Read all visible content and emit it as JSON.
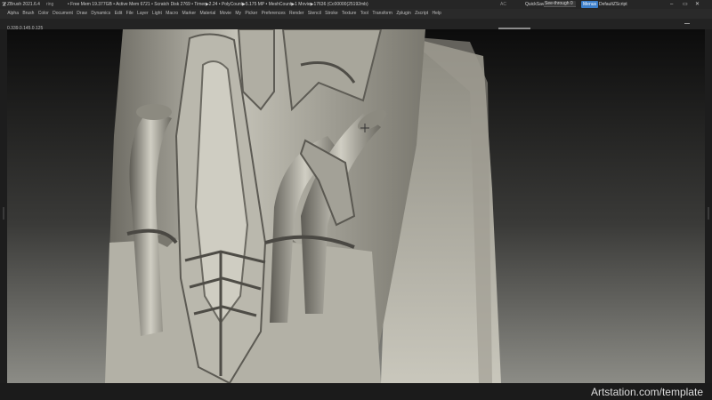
{
  "titlebar": {
    "app_title": "ZBrush 2021.6.4",
    "doc_name": "ring",
    "stats": "• Free Mem 19.377GB • Active Mem 6721 • Scratch Disk 2769 • Timer▶2.24 • PolyCount▶5.175 MP • MeshCount▶1  Movie▶17636 (Cc00000(25192mb)",
    "ac_label": "AC",
    "quicksave_label": "QuickSave",
    "seethrough_label": "See-through  0",
    "menus_label": "Menus",
    "script_label": "DefaultZScript",
    "minimize": "–",
    "restore": "▭",
    "close": "✕"
  },
  "menubar": {
    "items": [
      "Alpha",
      "Brush",
      "Color",
      "Document",
      "Draw",
      "Dynamics",
      "Edit",
      "File",
      "Layer",
      "Light",
      "Macro",
      "Marker",
      "Material",
      "Movie",
      "My",
      "Picker",
      "Preferences",
      "Render",
      "Stencil",
      "Stroke",
      "Texture",
      "Tool",
      "Transform",
      "Zplugin",
      "Zscript",
      "Help"
    ]
  },
  "readout": {
    "value": "0.339,0.145,0.125"
  },
  "watermark": "Artstation.com/template",
  "colors": {
    "accent": "#3c7ec9",
    "clay": "#b8b6ab",
    "background_top": "#0c0c0c",
    "background_bottom": "#8c8c86"
  },
  "icons": {
    "app_logo": "zbrush-logo-icon",
    "cursor": "brush-cursor-icon"
  }
}
